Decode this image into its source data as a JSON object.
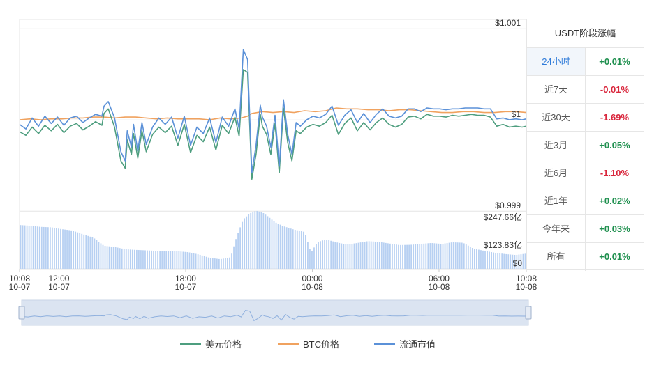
{
  "chart_data": {
    "type": "line",
    "title": "",
    "xlabel": "",
    "ylabel": "",
    "x_ticks": [
      {
        "time": "10:08",
        "date": "10-07"
      },
      {
        "time": "12:00",
        "date": "10-07"
      },
      {
        "time": "18:00",
        "date": "10-07"
      },
      {
        "time": "00:00",
        "date": "10-08"
      },
      {
        "time": "06:00",
        "date": "10-08"
      },
      {
        "time": "10:08",
        "date": "10-08"
      }
    ],
    "x_tick_hours": [
      0,
      1.867,
      7.867,
      13.867,
      19.867,
      24
    ],
    "x_range_hours": [
      0,
      24
    ],
    "price_axis": {
      "labels": [
        "$1.001",
        "$1",
        "$0.999"
      ],
      "values": [
        1.001,
        1.0,
        0.999
      ],
      "ylim": [
        0.999,
        1.0011
      ]
    },
    "volume_axis": {
      "labels": [
        "$247.66亿",
        "$123.83亿",
        "$0"
      ],
      "values": [
        247.66,
        123.83,
        0
      ],
      "ylim": [
        0,
        247.66
      ]
    },
    "grid": true,
    "legend_position": "bottom",
    "series": [
      {
        "name": "美元价格",
        "color": "#4e9e7f",
        "x": [
          0.0,
          0.3,
          0.6,
          0.9,
          1.2,
          1.5,
          1.8,
          2.1,
          2.4,
          2.7,
          3.0,
          3.3,
          3.6,
          3.9,
          4.0,
          4.2,
          4.5,
          4.8,
          5.0,
          5.1,
          5.3,
          5.4,
          5.6,
          5.8,
          6.0,
          6.3,
          6.6,
          6.9,
          7.2,
          7.5,
          7.8,
          8.1,
          8.4,
          8.7,
          9.0,
          9.3,
          9.6,
          9.9,
          10.2,
          10.4,
          10.6,
          10.8,
          11.0,
          11.2,
          11.4,
          11.5,
          11.7,
          11.9,
          12.1,
          12.3,
          12.5,
          12.7,
          12.9,
          13.1,
          13.3,
          13.6,
          13.9,
          14.2,
          14.5,
          14.8,
          15.1,
          15.4,
          15.7,
          16.0,
          16.3,
          16.6,
          16.9,
          17.2,
          17.5,
          17.8,
          18.1,
          18.4,
          18.7,
          19.0,
          19.3,
          19.6,
          19.9,
          20.2,
          20.5,
          20.8,
          21.1,
          21.4,
          21.7,
          22.0,
          22.3,
          22.6,
          22.9,
          23.2,
          23.5,
          23.8,
          24.0
        ],
        "values": [
          0.99987,
          0.99983,
          0.99992,
          0.99985,
          0.99994,
          0.99988,
          0.99995,
          0.99986,
          0.99993,
          0.99996,
          0.99989,
          0.99993,
          0.99998,
          0.99994,
          1.00007,
          1.00012,
          0.99992,
          0.99955,
          0.99947,
          0.99978,
          0.99962,
          0.99985,
          0.99958,
          0.99988,
          0.99965,
          0.99984,
          0.99992,
          0.99986,
          0.99993,
          0.99972,
          0.99995,
          0.99964,
          0.99983,
          0.99976,
          0.99992,
          0.99967,
          0.99994,
          0.99985,
          1.00003,
          0.99982,
          1.00055,
          1.00052,
          0.99935,
          0.99962,
          1.00006,
          0.99993,
          0.99984,
          0.99962,
          0.99996,
          0.99942,
          1.00013,
          0.99975,
          0.99955,
          0.99988,
          0.99985,
          0.99992,
          0.99995,
          0.99993,
          0.99997,
          1.00005,
          0.99984,
          0.99996,
          1.00002,
          0.99988,
          0.99997,
          0.99989,
          0.99997,
          1.00002,
          0.99995,
          0.99992,
          0.99995,
          1.00003,
          1.00004,
          1.00001,
          1.00006,
          1.00004,
          1.00004,
          1.00003,
          1.00005,
          1.00004,
          1.00005,
          1.00006,
          1.00005,
          1.00005,
          1.00003,
          0.99993,
          0.99995,
          0.99992,
          0.99993,
          0.99992,
          0.99993
        ]
      },
      {
        "name": "BTC价格",
        "color": "#f0a25f",
        "x": [
          0.0,
          0.5,
          1.0,
          1.5,
          2.0,
          2.5,
          3.0,
          3.5,
          4.0,
          4.5,
          5.0,
          5.5,
          6.0,
          6.5,
          7.0,
          7.5,
          8.0,
          8.5,
          9.0,
          9.5,
          10.0,
          10.5,
          10.8,
          11.0,
          11.5,
          12.0,
          12.5,
          13.0,
          13.5,
          14.0,
          14.5,
          15.0,
          15.5,
          16.0,
          16.5,
          17.0,
          17.5,
          18.0,
          18.5,
          19.0,
          19.5,
          20.0,
          20.5,
          21.0,
          21.5,
          22.0,
          22.5,
          23.0,
          23.5,
          24.0
        ],
        "values": [
          1.0,
          1.00001,
          1.0,
          1.00001,
          1.00001,
          1.00002,
          1.00002,
          1.00003,
          1.00003,
          1.00002,
          1.00003,
          1.00003,
          1.00002,
          1.00001,
          1.00002,
          1.00001,
          1.00001,
          1.00001,
          1.0,
          1.00002,
          1.00001,
          1.00002,
          1.00004,
          1.00007,
          1.00009,
          1.00008,
          1.00009,
          1.00008,
          1.0001,
          1.00009,
          1.0001,
          1.00013,
          1.00012,
          1.00012,
          1.00011,
          1.00011,
          1.0001,
          1.00011,
          1.00011,
          1.0001,
          1.00009,
          1.00008,
          1.00008,
          1.00009,
          1.00009,
          1.00008,
          1.00008,
          1.00009,
          1.00009,
          1.00008
        ]
      },
      {
        "name": "流通市值",
        "color": "#5b91d8",
        "x": [
          0.0,
          0.3,
          0.6,
          0.9,
          1.2,
          1.5,
          1.8,
          2.1,
          2.4,
          2.7,
          3.0,
          3.3,
          3.6,
          3.9,
          4.0,
          4.2,
          4.5,
          4.8,
          5.0,
          5.1,
          5.3,
          5.4,
          5.6,
          5.8,
          6.0,
          6.3,
          6.6,
          6.9,
          7.2,
          7.5,
          7.8,
          8.1,
          8.4,
          8.7,
          9.0,
          9.3,
          9.6,
          9.9,
          10.2,
          10.4,
          10.6,
          10.8,
          11.0,
          11.2,
          11.4,
          11.5,
          11.7,
          11.9,
          12.1,
          12.3,
          12.5,
          12.7,
          12.9,
          13.1,
          13.3,
          13.6,
          13.9,
          14.2,
          14.5,
          14.8,
          15.1,
          15.4,
          15.7,
          16.0,
          16.3,
          16.6,
          16.9,
          17.2,
          17.5,
          17.8,
          18.1,
          18.4,
          18.7,
          19.0,
          19.3,
          19.6,
          19.9,
          20.2,
          20.5,
          20.8,
          21.1,
          21.4,
          21.7,
          22.0,
          22.3,
          22.6,
          22.9,
          23.2,
          23.5,
          23.8,
          24.0
        ],
        "values": [
          0.99995,
          0.9999,
          1.00002,
          0.99993,
          1.00004,
          0.99996,
          1.00003,
          0.99994,
          1.00002,
          1.00004,
          0.99997,
          1.00002,
          1.00006,
          1.00004,
          1.00015,
          1.0002,
          1.00002,
          0.99965,
          0.99955,
          0.99988,
          0.9997,
          0.99995,
          0.99966,
          0.99997,
          0.99973,
          0.99992,
          1.00002,
          0.99995,
          1.00003,
          0.9998,
          1.00004,
          0.99972,
          0.99992,
          0.99985,
          1.00002,
          0.99975,
          1.00003,
          0.99993,
          1.00012,
          0.9999,
          1.00077,
          1.00066,
          0.99942,
          0.99972,
          1.00016,
          1.00003,
          0.99993,
          0.9997,
          1.00005,
          0.99949,
          1.00022,
          0.99984,
          0.99962,
          0.99997,
          0.99993,
          1.0,
          1.00004,
          1.00002,
          1.00006,
          1.00015,
          0.99994,
          1.00005,
          1.00011,
          0.99997,
          1.00007,
          0.99997,
          1.00006,
          1.00012,
          1.00004,
          1.00002,
          1.00004,
          1.00012,
          1.00012,
          1.00009,
          1.00013,
          1.00012,
          1.00012,
          1.00011,
          1.00012,
          1.00012,
          1.00013,
          1.00013,
          1.00013,
          1.00012,
          1.00012,
          1.00001,
          1.00002,
          1.0,
          1.00001,
          1.0,
          1.00001
        ]
      }
    ],
    "volume": {
      "color": "#b7d0f2",
      "x": [
        0.0,
        0.5,
        1.0,
        1.5,
        2.0,
        2.5,
        3.0,
        3.5,
        4.0,
        4.5,
        5.0,
        5.5,
        6.0,
        6.5,
        7.0,
        7.5,
        8.0,
        8.5,
        9.0,
        9.5,
        10.0,
        10.3,
        10.6,
        10.9,
        11.2,
        11.5,
        11.8,
        12.1,
        12.5,
        13.0,
        13.5,
        13.8,
        14.1,
        14.5,
        15.0,
        15.5,
        16.0,
        16.5,
        17.0,
        17.5,
        18.0,
        18.5,
        19.0,
        19.5,
        20.0,
        20.5,
        21.0,
        21.5,
        22.0,
        22.5,
        23.0,
        23.5,
        24.0
      ],
      "values": [
        190,
        187,
        182,
        180,
        172,
        166,
        150,
        135,
        100,
        95,
        85,
        82,
        80,
        78,
        78,
        76,
        72,
        62,
        48,
        42,
        50,
        145,
        215,
        240,
        252,
        245,
        225,
        202,
        185,
        170,
        160,
        70,
        115,
        128,
        115,
        105,
        112,
        120,
        117,
        110,
        103,
        104,
        108,
        112,
        108,
        115,
        113,
        88,
        78,
        70,
        64,
        60,
        66
      ]
    }
  },
  "period_panel": {
    "title": "USDT阶段涨幅",
    "rows": [
      {
        "label": "24小时",
        "value": "+0.01%",
        "trend": "up",
        "active": true
      },
      {
        "label": "近7天",
        "value": "-0.01%",
        "trend": "down",
        "active": false
      },
      {
        "label": "近30天",
        "value": "-1.69%",
        "trend": "down",
        "active": false
      },
      {
        "label": "近3月",
        "value": "+0.05%",
        "trend": "up",
        "active": false
      },
      {
        "label": "近6月",
        "value": "-1.10%",
        "trend": "down",
        "active": false
      },
      {
        "label": "近1年",
        "value": "+0.02%",
        "trend": "up",
        "active": false
      },
      {
        "label": "今年来",
        "value": "+0.03%",
        "trend": "up",
        "active": false
      },
      {
        "label": "所有",
        "value": "+0.01%",
        "trend": "up",
        "active": false
      }
    ]
  },
  "legend": [
    {
      "label": "美元价格",
      "color": "#4e9e7f"
    },
    {
      "label": "BTC价格",
      "color": "#f0a25f"
    },
    {
      "label": "流通市值",
      "color": "#5b91d8"
    }
  ]
}
